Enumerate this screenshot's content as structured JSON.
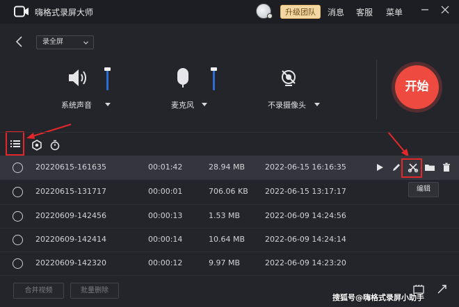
{
  "titlebar": {
    "title": "嗨格式录屏大师",
    "upgrade_label": "升级团队",
    "menu": [
      "消息",
      "客服",
      "菜单"
    ]
  },
  "recorder": {
    "mode": "录全屏",
    "devices": [
      {
        "label": "系统声音",
        "icon": "speaker-icon"
      },
      {
        "label": "麦克风",
        "icon": "microphone-icon"
      },
      {
        "label": "不录摄像头",
        "icon": "camera-off-icon"
      }
    ],
    "start_label": "开始"
  },
  "files": [
    {
      "name": "20220615-161635",
      "duration": "00:01:42",
      "size": "28.94 MB",
      "date": "2022-06-15 16:16:35"
    },
    {
      "name": "20220615-131717",
      "duration": "00:00:01",
      "size": "706.06 KB",
      "date": "2022-06-15 13:17:17"
    },
    {
      "name": "20220609-142456",
      "duration": "00:00:13",
      "size": "1.53 MB",
      "date": "2022-06-09 14:24:56"
    },
    {
      "name": "20220609-142414",
      "duration": "00:00:14",
      "size": "10.64 MB",
      "date": "2022-06-09 14:24:14"
    },
    {
      "name": "20220609-142320",
      "duration": "00:00:12",
      "size": "9.97 MB",
      "date": "2022-06-09 14:23:20"
    }
  ],
  "tooltip": "编辑",
  "bottom": {
    "merge_label": "合并视频",
    "batch_delete_label": "批量删除"
  },
  "watermark": "搜狐号@嗨格式录屏小助手",
  "colors": {
    "accent": "#ef4a3f",
    "highlight": "#e4282a",
    "slider": "#2a6ed6"
  }
}
